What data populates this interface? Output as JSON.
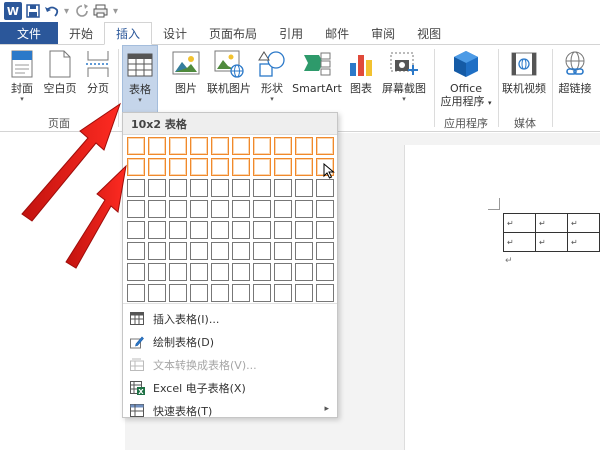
{
  "qat": {
    "logo": "W",
    "undo_icon": "undo-icon",
    "redo_icon": "redo-icon"
  },
  "tabs": [
    "文件",
    "开始",
    "插入",
    "设计",
    "页面布局",
    "引用",
    "邮件",
    "审阅",
    "视图"
  ],
  "ribbon": {
    "cover": {
      "label": "封面",
      "caret": "▾"
    },
    "blank": {
      "label": "空白页"
    },
    "pagebreak": {
      "label": "分页"
    },
    "table": {
      "label": "表格",
      "caret": "▾"
    },
    "picture": {
      "label": "图片"
    },
    "online_picture": {
      "label": "联机图片"
    },
    "shapes": {
      "label": "形状",
      "caret": "▾"
    },
    "smartart": {
      "label": "SmartArt"
    },
    "chart": {
      "label": "图表"
    },
    "screenshot": {
      "label": "屏幕截图",
      "caret": "▾"
    },
    "office_apps": {
      "label1": "Office",
      "label2": "应用程序",
      "caret": "▾"
    },
    "online_video": {
      "label": "联机视频"
    },
    "hyperlink": {
      "label": "超链接"
    },
    "groups": {
      "pages": "页面",
      "apps": "应用程序",
      "media": "媒体"
    }
  },
  "dropdown": {
    "header": "10x2 表格",
    "grid_cols": 10,
    "grid_rows": 8,
    "selected_cols": 10,
    "selected_rows": 2,
    "items": [
      {
        "label": "插入表格(I)...",
        "disabled": false,
        "submenu": false
      },
      {
        "label": "绘制表格(D)",
        "disabled": false,
        "submenu": false
      },
      {
        "label": "文本转换成表格(V)...",
        "disabled": true,
        "submenu": false
      },
      {
        "label": "Excel 电子表格(X)",
        "disabled": false,
        "submenu": false
      },
      {
        "label": "快速表格(T)",
        "disabled": false,
        "submenu": true
      }
    ],
    "submenu_arrow": "▸"
  },
  "document": {
    "cell_mark": "↵",
    "para_mark": "↵"
  },
  "colors": {
    "accent": "#2b579a",
    "highlight": "#f0892c",
    "arrow": "#e0201c"
  }
}
